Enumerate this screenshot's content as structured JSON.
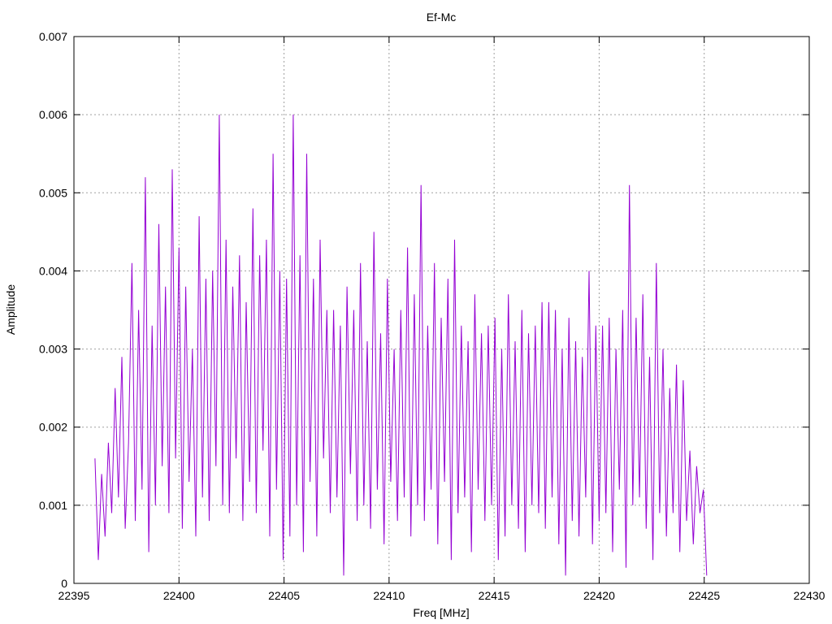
{
  "chart_data": {
    "type": "line",
    "title": "Ef-Mc",
    "xlabel": "Freq [MHz]",
    "ylabel": "Amplitude",
    "xlim": [
      22395,
      22430
    ],
    "ylim": [
      0,
      0.007
    ],
    "xticks": [
      22395,
      22400,
      22405,
      22410,
      22415,
      22420,
      22425,
      22430
    ],
    "yticks": [
      "0",
      "0.001",
      "0.002",
      "0.003",
      "0.004",
      "0.005",
      "0.006",
      "0.007"
    ],
    "grid": true,
    "color": "#9400d3",
    "series": [
      {
        "name": "Ef-Mc",
        "x_start": 22396.0,
        "x_step": 0.16,
        "y_unit_scale": 0.001,
        "values": [
          1.6,
          0.3,
          1.4,
          0.6,
          1.8,
          0.9,
          2.5,
          1.1,
          2.9,
          0.7,
          1.8,
          4.1,
          0.8,
          3.5,
          1.2,
          5.2,
          0.4,
          3.3,
          1.0,
          4.6,
          1.5,
          3.8,
          0.9,
          5.3,
          1.6,
          4.3,
          0.7,
          3.8,
          1.3,
          3.0,
          0.6,
          4.7,
          1.1,
          3.9,
          0.8,
          4.0,
          1.5,
          6.0,
          1.0,
          4.4,
          0.9,
          3.8,
          1.6,
          4.2,
          0.8,
          3.6,
          1.3,
          4.8,
          0.9,
          4.2,
          1.7,
          4.4,
          0.6,
          5.5,
          1.2,
          4.0,
          0.3,
          3.9,
          0.6,
          6.0,
          1.0,
          4.2,
          0.4,
          5.5,
          1.3,
          3.9,
          0.6,
          4.4,
          1.6,
          3.5,
          0.9,
          3.5,
          1.1,
          3.3,
          0.1,
          3.8,
          1.4,
          3.5,
          0.8,
          4.1,
          1.0,
          3.1,
          0.7,
          4.5,
          1.2,
          3.2,
          0.5,
          3.9,
          1.3,
          3.0,
          0.8,
          3.5,
          1.1,
          4.3,
          0.6,
          3.7,
          1.0,
          5.1,
          0.8,
          3.3,
          1.2,
          4.1,
          0.5,
          3.4,
          1.3,
          3.9,
          0.3,
          4.4,
          0.9,
          3.3,
          1.1,
          3.1,
          0.4,
          3.7,
          1.2,
          3.2,
          0.8,
          3.3,
          1.0,
          3.4,
          0.3,
          3.0,
          0.6,
          3.7,
          1.0,
          3.1,
          0.7,
          3.5,
          0.4,
          3.2,
          1.0,
          3.3,
          0.9,
          3.6,
          0.7,
          3.6,
          1.1,
          3.5,
          0.5,
          3.0,
          0.1,
          3.4,
          0.8,
          3.1,
          0.6,
          2.9,
          1.1,
          4.0,
          0.5,
          3.3,
          0.8,
          3.3,
          0.9,
          3.4,
          0.4,
          3.0,
          1.2,
          3.5,
          0.2,
          5.1,
          1.0,
          3.4,
          1.1,
          3.7,
          0.7,
          2.9,
          0.3,
          4.1,
          0.9,
          3.0,
          0.6,
          2.5,
          0.9,
          2.8,
          0.4,
          2.6,
          0.8,
          1.7,
          0.5,
          1.5,
          0.9,
          1.2,
          0.1
        ]
      }
    ]
  }
}
